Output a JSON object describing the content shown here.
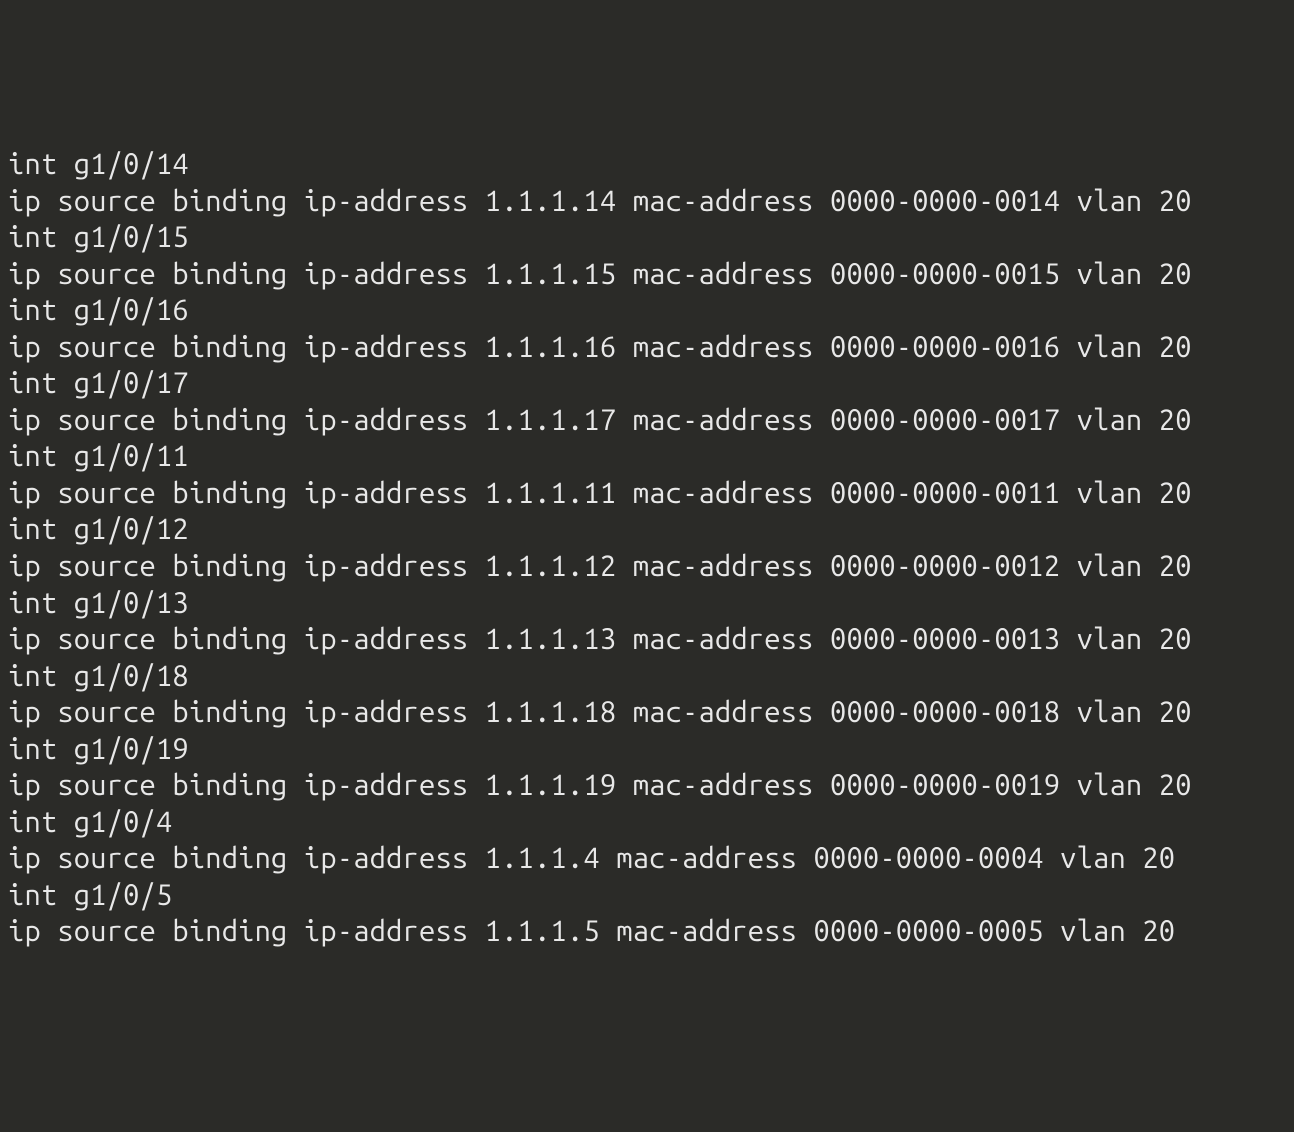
{
  "terminal": {
    "lines": [
      "int g1/0/14",
      "ip source binding ip-address 1.1.1.14 mac-address 0000-0000-0014 vlan 20",
      "int g1/0/15",
      "ip source binding ip-address 1.1.1.15 mac-address 0000-0000-0015 vlan 20",
      "int g1/0/16",
      "ip source binding ip-address 1.1.1.16 mac-address 0000-0000-0016 vlan 20",
      "int g1/0/17",
      "ip source binding ip-address 1.1.1.17 mac-address 0000-0000-0017 vlan 20",
      "int g1/0/11",
      "ip source binding ip-address 1.1.1.11 mac-address 0000-0000-0011 vlan 20",
      "int g1/0/12",
      "ip source binding ip-address 1.1.1.12 mac-address 0000-0000-0012 vlan 20",
      "int g1/0/13",
      "ip source binding ip-address 1.1.1.13 mac-address 0000-0000-0013 vlan 20",
      "int g1/0/18",
      "ip source binding ip-address 1.1.1.18 mac-address 0000-0000-0018 vlan 20",
      "int g1/0/19",
      "ip source binding ip-address 1.1.1.19 mac-address 0000-0000-0019 vlan 20",
      "int g1/0/4",
      "ip source binding ip-address 1.1.1.4 mac-address 0000-0000-0004 vlan 20",
      "int g1/0/5",
      "ip source binding ip-address 1.1.1.5 mac-address 0000-0000-0005 vlan 20"
    ]
  }
}
